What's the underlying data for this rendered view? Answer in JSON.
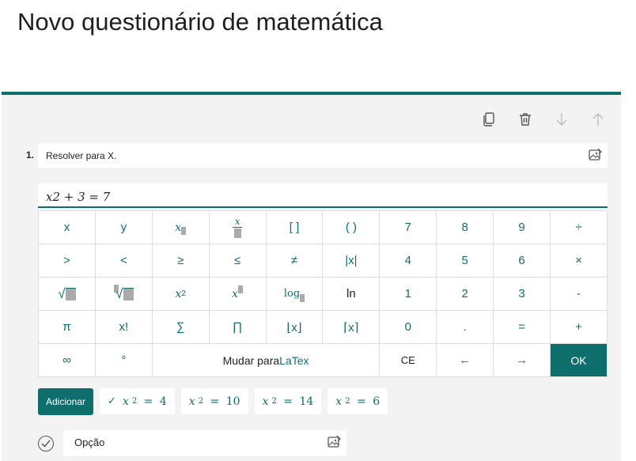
{
  "page": {
    "title": "Novo questionário de matemática"
  },
  "toolbar": {
    "copy_icon": "copy-icon",
    "delete_icon": "trash-icon",
    "down_icon": "arrow-down-icon",
    "up_icon": "arrow-up-icon"
  },
  "question": {
    "number": "1.",
    "text": "Resolver para X.",
    "equation": "x2 + 3 = 7"
  },
  "keypad": {
    "row1": [
      "x",
      "y",
      "",
      "",
      "[ ]",
      "( )",
      "7",
      "8",
      "9",
      "÷"
    ],
    "row2": [
      ">",
      "<",
      "≥",
      "≤",
      "≠",
      "|x|",
      "4",
      "5",
      "6",
      "×"
    ],
    "row3": [
      "",
      "",
      "",
      "",
      "log",
      "ln",
      "1",
      "2",
      "3",
      "-"
    ],
    "row4": [
      "π",
      "x!",
      "∑",
      "∏",
      "⌊x⌋",
      "⌈x⌉",
      "0",
      ".",
      "=",
      "+"
    ],
    "row5_first": "∞",
    "row5_second": "°",
    "latex_prefix": "Mudar para ",
    "latex_word": "LaTex",
    "ce": "CE",
    "left": "←",
    "right": "→",
    "ok": "OK",
    "x2_base": "x",
    "x2_exp": "2"
  },
  "answers": {
    "add_label": "Adicionar",
    "items": [
      {
        "var": "x",
        "sub": "2",
        "eq": " = ",
        "val": "4"
      },
      {
        "var": "x",
        "sub": "2",
        "eq": " = ",
        "val": "10"
      },
      {
        "var": "x",
        "sub": "2",
        "eq": " = ",
        "val": "14"
      },
      {
        "var": "x",
        "sub": "2",
        "eq": " = ",
        "val": "6"
      }
    ]
  },
  "option": {
    "text": "Opção"
  },
  "colors": {
    "accent": "#0e6e6b"
  }
}
